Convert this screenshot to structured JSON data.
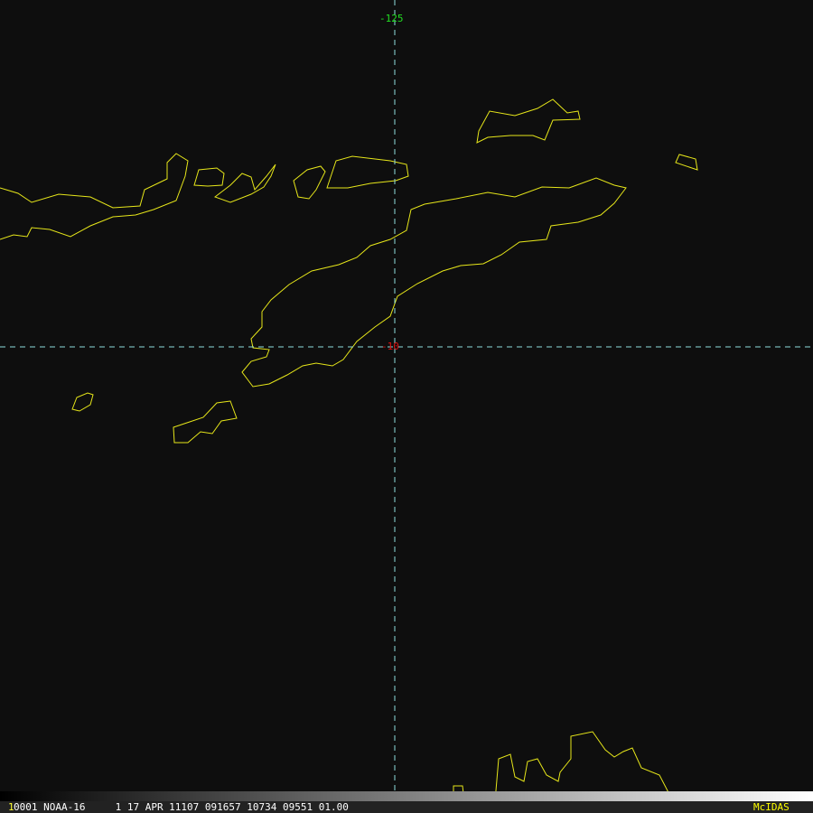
{
  "grid": {
    "longitude_label": "-125",
    "latitude_label": "-10",
    "longitude_label_color": "#22dd22",
    "latitude_label_color": "#dd1111",
    "line_color": "#8fdede"
  },
  "coastline_color": "#e6e61a",
  "status": {
    "frame_number": "1",
    "info": "0001 NOAA-16     1 17 APR 11107 091657 10734 09551 01.00",
    "brand": "McIDAS",
    "frame_color": "#ffff33",
    "brand_color": "#ffff00"
  }
}
